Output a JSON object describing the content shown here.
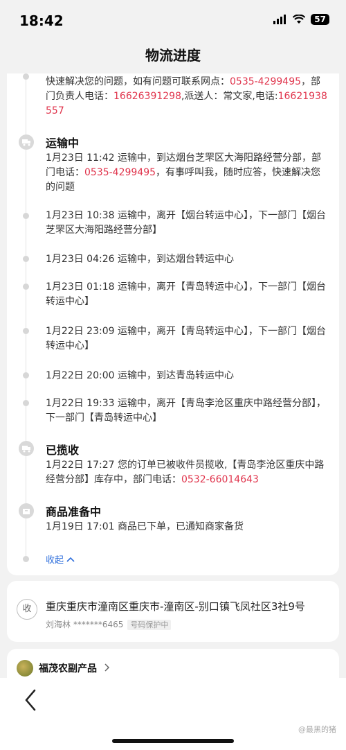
{
  "status_bar": {
    "time": "18:42",
    "battery": "57"
  },
  "header": {
    "title": "物流进度"
  },
  "timeline": {
    "top_fragment": {
      "p1": "快速解决您的问题，如有问题可联系网点：",
      "phone1": "0535-4299495",
      "p2": "，部门负责人电话：",
      "phone2": "16626391298",
      "p3": ",派送人：常文家,电话:",
      "phone3": "16621938557"
    },
    "groups": [
      {
        "title": "运输中",
        "icon": "truck-icon",
        "entries": [
          {
            "p1": "1月23日 11:42 运输中，到达烟台芝罘区大海阳路经营分部，部门电话：",
            "phone": "0535-4299495",
            "p2": "，有事呼叫我，随时应答，快速解决您的问题"
          },
          {
            "text": "1月23日 10:38 运输中，离开【烟台转运中心】，下一部门【烟台芝罘区大海阳路经营分部】"
          },
          {
            "text": "1月23日 04:26 运输中，到达烟台转运中心"
          },
          {
            "text": "1月23日 01:18 运输中，离开【青岛转运中心】，下一部门【烟台转运中心】"
          },
          {
            "text": "1月22日 23:09 运输中，离开【青岛转运中心】，下一部门【烟台转运中心】"
          },
          {
            "text": "1月22日 20:00 运输中，到达青岛转运中心"
          },
          {
            "text": "1月22日 19:33 运输中，离开【青岛李沧区重庆中路经营分部】，下一部门【青岛转运中心】"
          }
        ]
      },
      {
        "title": "已揽收",
        "icon": "truck-icon",
        "entries": [
          {
            "p1": "1月22日 17:27 您的订单已被收件员揽收,【青岛李沧区重庆中路经营分部】库存中，部门电话：",
            "phone": "0532-66014643"
          }
        ]
      },
      {
        "title": "商品准备中",
        "icon": "box-icon",
        "entries": [
          {
            "text": "1月19日 17:01 商品已下单，已通知商家备货"
          }
        ]
      }
    ],
    "collapse_label": "收起"
  },
  "address": {
    "badge": "收",
    "text": "重庆重庆市潼南区重庆市-潼南区-别口镇飞凤社区3社9号",
    "name_phone": "刘海林 *******6465",
    "tag": "号码保护中"
  },
  "shop": {
    "name": "福茂农副产品"
  },
  "watermark": "@最黑的猪",
  "colors": {
    "phone_highlight": "#e0344c",
    "link": "#2f6fdc"
  }
}
